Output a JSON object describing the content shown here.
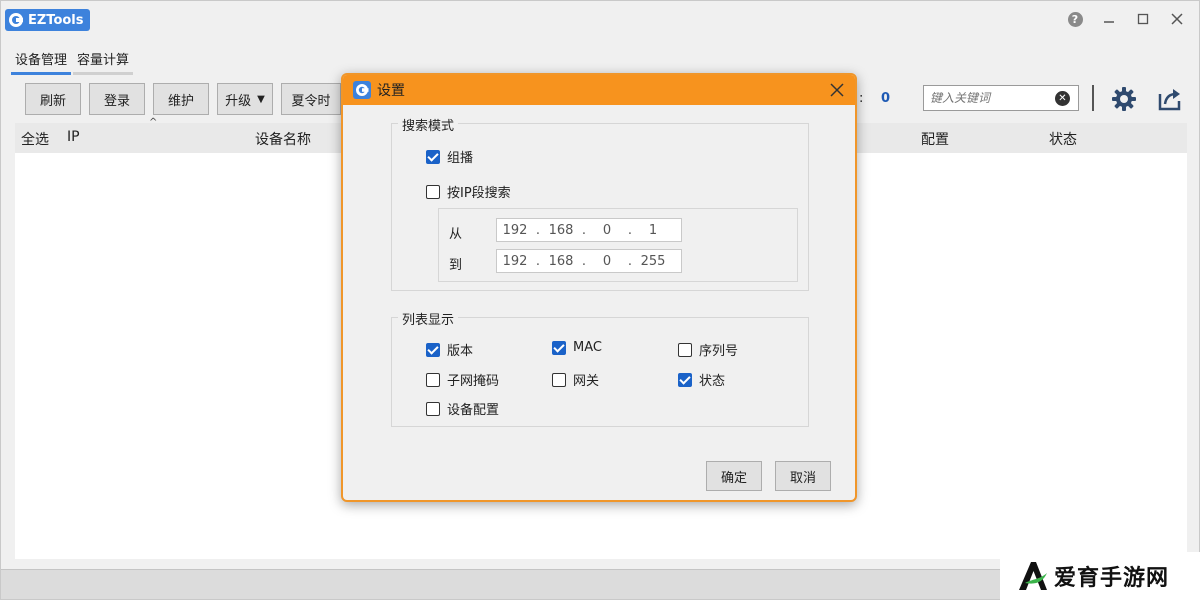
{
  "window": {
    "title": "EZTools"
  },
  "tabs": [
    {
      "label": "设备管理",
      "active": true
    },
    {
      "label": "容量计算",
      "active": false
    }
  ],
  "toolbar": {
    "refresh": "刷新",
    "login": "登录",
    "maintain": "维护",
    "upgrade": "升级",
    "dst": "夏令时",
    "count_label": ":",
    "count_value": "0",
    "search_placeholder": "键入关键词"
  },
  "table": {
    "columns": [
      "全选",
      "IP",
      "设备名称",
      "配置",
      "状态"
    ]
  },
  "dialog": {
    "title": "设置",
    "search_mode": {
      "title": "搜索模式",
      "multicast": {
        "label": "组播",
        "checked": true
      },
      "by_ip": {
        "label": "按IP段搜索",
        "checked": false
      },
      "from_label": "从",
      "to_label": "到",
      "from_ip": [
        "192",
        "168",
        "0",
        "1"
      ],
      "to_ip": [
        "192",
        "168",
        "0",
        "255"
      ]
    },
    "list_display": {
      "title": "列表显示",
      "items": [
        {
          "label": "版本",
          "checked": true
        },
        {
          "label": "MAC",
          "checked": true
        },
        {
          "label": "序列号",
          "checked": false
        },
        {
          "label": "子网掩码",
          "checked": false
        },
        {
          "label": "网关",
          "checked": false
        },
        {
          "label": "状态",
          "checked": true
        },
        {
          "label": "设备配置",
          "checked": false
        }
      ]
    },
    "ok": "确定",
    "cancel": "取消"
  },
  "watermark": {
    "text": "爱育手游网"
  },
  "colors": {
    "accent": "#3d82dc",
    "dialog_title": "#f7931e",
    "checkbox": "#1a62c8"
  }
}
